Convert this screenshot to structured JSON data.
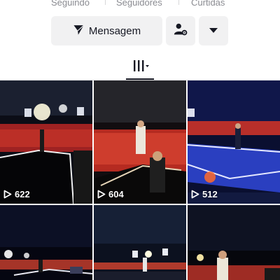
{
  "profile": {
    "stats": [
      {
        "label": "Seguindo"
      },
      {
        "label": "Seguidores"
      },
      {
        "label": "Curtidas"
      }
    ],
    "message_button": "Mensagem",
    "add_friend_icon": "user-gear-icon",
    "more_icon": "chevron-down-icon"
  },
  "tabs": {
    "active": "videos-grid-tab"
  },
  "videos": [
    {
      "views": "622"
    },
    {
      "views": "604"
    },
    {
      "views": "512"
    },
    {
      "views": ""
    },
    {
      "views": ""
    },
    {
      "views": ""
    }
  ],
  "colors": {
    "background": "#ffffff",
    "button_bg": "#f1f1f2",
    "text_primary": "#161823",
    "text_secondary": "#8a8b91"
  }
}
